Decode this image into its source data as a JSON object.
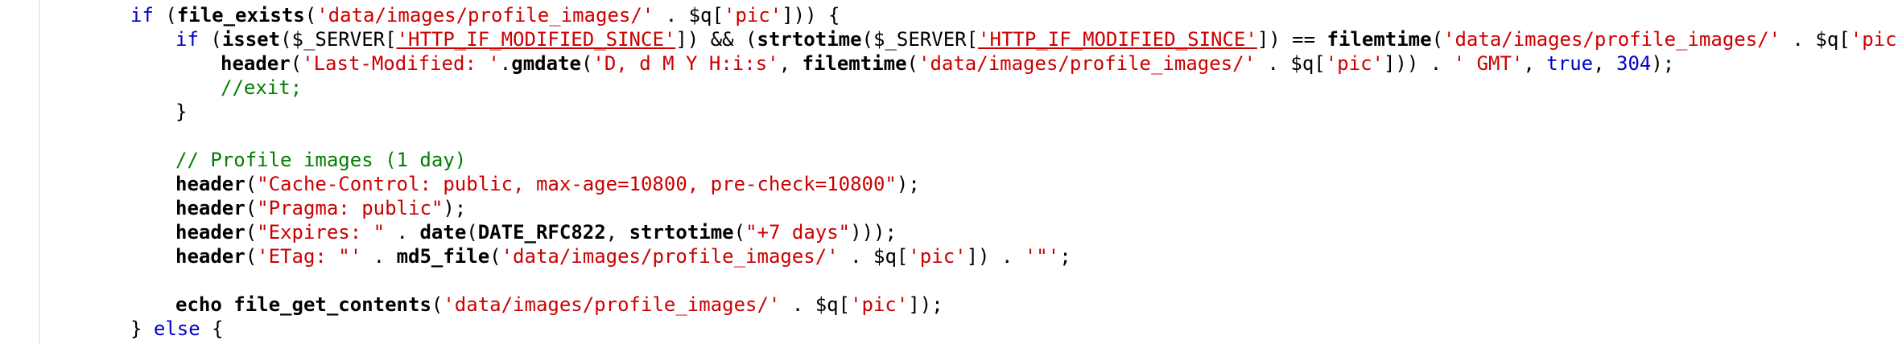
{
  "editor": {
    "lines": [
      {
        "indent": 1,
        "tokens": [
          {
            "t": "kw",
            "v": "if"
          },
          {
            "t": "plain",
            "v": " ("
          },
          {
            "t": "fn",
            "v": "file_exists"
          },
          {
            "t": "plain",
            "v": "("
          },
          {
            "t": "str",
            "v": "'data/images/profile_images/'"
          },
          {
            "t": "plain",
            "v": " . $q["
          },
          {
            "t": "str",
            "v": "'pic'"
          },
          {
            "t": "plain",
            "v": "])) {"
          }
        ]
      },
      {
        "indent": 2,
        "tokens": [
          {
            "t": "kw",
            "v": "if"
          },
          {
            "t": "plain",
            "v": " ("
          },
          {
            "t": "fn",
            "v": "isset"
          },
          {
            "t": "plain",
            "v": "($_SERVER["
          },
          {
            "t": "str ul",
            "v": "'HTTP_IF_MODIFIED_SINCE'"
          },
          {
            "t": "plain",
            "v": "]) && ("
          },
          {
            "t": "fn",
            "v": "strtotime"
          },
          {
            "t": "plain",
            "v": "($_SERVER["
          },
          {
            "t": "str ul",
            "v": "'HTTP_IF_MODIFIED_SINCE'"
          },
          {
            "t": "plain",
            "v": "]) == "
          },
          {
            "t": "fn",
            "v": "filemtime"
          },
          {
            "t": "plain",
            "v": "("
          },
          {
            "t": "str",
            "v": "'data/images/profile_images/'"
          },
          {
            "t": "plain",
            "v": " . $q["
          },
          {
            "t": "str",
            "v": "'pic'"
          },
          {
            "t": "plain",
            "v": "]))) {"
          }
        ]
      },
      {
        "indent": 3,
        "tokens": [
          {
            "t": "fn",
            "v": "header"
          },
          {
            "t": "plain",
            "v": "("
          },
          {
            "t": "str",
            "v": "'Last-Modified: '"
          },
          {
            "t": "plain",
            "v": "."
          },
          {
            "t": "fn",
            "v": "gmdate"
          },
          {
            "t": "plain",
            "v": "("
          },
          {
            "t": "str",
            "v": "'D, d M Y H:i:s'"
          },
          {
            "t": "plain",
            "v": ", "
          },
          {
            "t": "fn",
            "v": "filemtime"
          },
          {
            "t": "plain",
            "v": "("
          },
          {
            "t": "str",
            "v": "'data/images/profile_images/'"
          },
          {
            "t": "plain",
            "v": " . $q["
          },
          {
            "t": "str",
            "v": "'pic'"
          },
          {
            "t": "plain",
            "v": "])) . "
          },
          {
            "t": "str",
            "v": "' GMT'"
          },
          {
            "t": "plain",
            "v": ", "
          },
          {
            "t": "kw",
            "v": "true"
          },
          {
            "t": "plain",
            "v": ", "
          },
          {
            "t": "num",
            "v": "304"
          },
          {
            "t": "plain",
            "v": ");"
          }
        ]
      },
      {
        "indent": 3,
        "tokens": [
          {
            "t": "cmt",
            "v": "//exit;"
          }
        ]
      },
      {
        "indent": 2,
        "tokens": [
          {
            "t": "plain",
            "v": "}"
          }
        ]
      },
      {
        "indent": 0,
        "tokens": []
      },
      {
        "indent": 2,
        "tokens": [
          {
            "t": "cmt",
            "v": "// Profile images (1 day)"
          }
        ]
      },
      {
        "indent": 2,
        "tokens": [
          {
            "t": "fn",
            "v": "header"
          },
          {
            "t": "plain",
            "v": "("
          },
          {
            "t": "str",
            "v": "\"Cache-Control: public, max-age=10800, pre-check=10800\""
          },
          {
            "t": "plain",
            "v": ");"
          }
        ]
      },
      {
        "indent": 2,
        "tokens": [
          {
            "t": "fn",
            "v": "header"
          },
          {
            "t": "plain",
            "v": "("
          },
          {
            "t": "str",
            "v": "\"Pragma: public\""
          },
          {
            "t": "plain",
            "v": ");"
          }
        ]
      },
      {
        "indent": 2,
        "tokens": [
          {
            "t": "fn",
            "v": "header"
          },
          {
            "t": "plain",
            "v": "("
          },
          {
            "t": "str",
            "v": "\"Expires: \""
          },
          {
            "t": "plain",
            "v": " . "
          },
          {
            "t": "fn",
            "v": "date"
          },
          {
            "t": "plain",
            "v": "("
          },
          {
            "t": "fn",
            "v": "DATE_RFC822"
          },
          {
            "t": "plain",
            "v": ", "
          },
          {
            "t": "fn",
            "v": "strtotime"
          },
          {
            "t": "plain",
            "v": "("
          },
          {
            "t": "str",
            "v": "\"+7 days\""
          },
          {
            "t": "plain",
            "v": ")));"
          }
        ]
      },
      {
        "indent": 2,
        "tokens": [
          {
            "t": "fn",
            "v": "header"
          },
          {
            "t": "plain",
            "v": "("
          },
          {
            "t": "str",
            "v": "'ETag: \"'"
          },
          {
            "t": "plain",
            "v": " . "
          },
          {
            "t": "fn",
            "v": "md5_file"
          },
          {
            "t": "plain",
            "v": "("
          },
          {
            "t": "str",
            "v": "'data/images/profile_images/'"
          },
          {
            "t": "plain",
            "v": " . $q["
          },
          {
            "t": "str",
            "v": "'pic'"
          },
          {
            "t": "plain",
            "v": "]) . "
          },
          {
            "t": "str",
            "v": "'\"'"
          },
          {
            "t": "plain",
            "v": ";"
          }
        ]
      },
      {
        "indent": 0,
        "tokens": []
      },
      {
        "indent": 2,
        "tokens": [
          {
            "t": "fn",
            "v": "echo"
          },
          {
            "t": "plain",
            "v": " "
          },
          {
            "t": "fn",
            "v": "file_get_contents"
          },
          {
            "t": "plain",
            "v": "("
          },
          {
            "t": "str",
            "v": "'data/images/profile_images/'"
          },
          {
            "t": "plain",
            "v": " . $q["
          },
          {
            "t": "str",
            "v": "'pic'"
          },
          {
            "t": "plain",
            "v": "]);"
          }
        ]
      },
      {
        "indent": 1,
        "tokens": [
          {
            "t": "plain",
            "v": "} "
          },
          {
            "t": "kw",
            "v": "else"
          },
          {
            "t": "plain",
            "v": " {"
          }
        ]
      }
    ]
  }
}
